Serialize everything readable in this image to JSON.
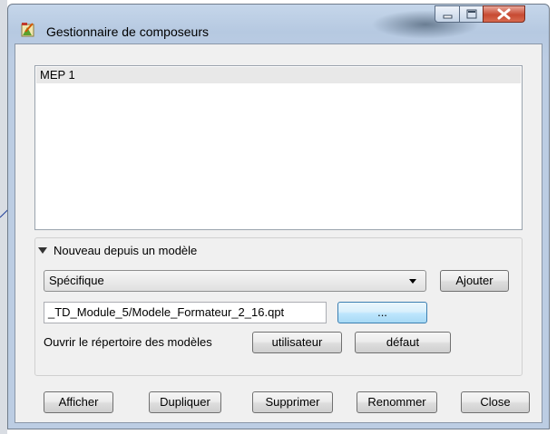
{
  "window": {
    "title": "Gestionnaire de composeurs"
  },
  "composers": [
    {
      "name": "MEP 1"
    }
  ],
  "template_section": {
    "title": "Nouveau depuis un modèle",
    "combo_value": "Spécifique",
    "add_label": "Ajouter",
    "path_value": "_TD_Module_5/Modele_Formateur_2_16.qpt",
    "browse_label": "...",
    "open_dir_label": "Ouvrir le répertoire des modèles",
    "user_label": "utilisateur",
    "default_label": "défaut"
  },
  "actions": {
    "show": "Afficher",
    "duplicate": "Dupliquer",
    "delete": "Supprimer",
    "rename": "Renommer",
    "close": "Close"
  }
}
